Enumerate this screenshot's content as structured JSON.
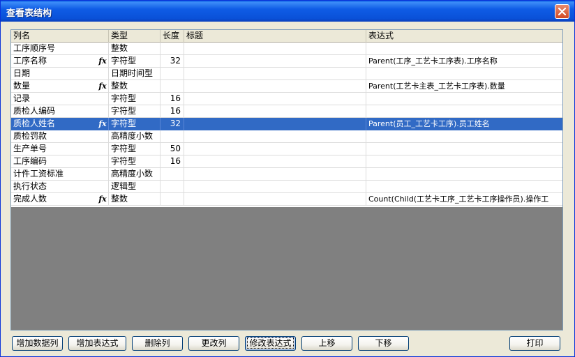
{
  "window": {
    "title": "查看表结构"
  },
  "grid": {
    "headers": {
      "name": "列名",
      "type": "类型",
      "length": "长度",
      "title": "标题",
      "expression": "表达式"
    },
    "rows": [
      {
        "name": "工序顺序号",
        "fx": "",
        "type": "整数",
        "length": "",
        "title": "",
        "expression": ""
      },
      {
        "name": "工序名称",
        "fx": "fx",
        "type": "字符型",
        "length": "32",
        "title": "",
        "expression": "Parent(工序_工艺卡工序表).工序名称"
      },
      {
        "name": "日期",
        "fx": "",
        "type": "日期时间型",
        "length": "",
        "title": "",
        "expression": ""
      },
      {
        "name": "数量",
        "fx": "fx",
        "type": "整数",
        "length": "",
        "title": "",
        "expression": "Parent(工艺卡主表_工艺卡工序表).数量"
      },
      {
        "name": "记录",
        "fx": "",
        "type": "字符型",
        "length": "16",
        "title": "",
        "expression": ""
      },
      {
        "name": "质检人编码",
        "fx": "",
        "type": "字符型",
        "length": "16",
        "title": "",
        "expression": ""
      },
      {
        "name": "质检人姓名",
        "fx": "fx",
        "type": "字符型",
        "length": "32",
        "title": "",
        "expression": "Parent(员工_工艺卡工序).员工姓名"
      },
      {
        "name": "质检罚款",
        "fx": "",
        "type": "高精度小数",
        "length": "",
        "title": "",
        "expression": ""
      },
      {
        "name": "生产单号",
        "fx": "",
        "type": "字符型",
        "length": "50",
        "title": "",
        "expression": ""
      },
      {
        "name": "工序编码",
        "fx": "",
        "type": "字符型",
        "length": "16",
        "title": "",
        "expression": ""
      },
      {
        "name": "计件工资标准",
        "fx": "",
        "type": "高精度小数",
        "length": "",
        "title": "",
        "expression": ""
      },
      {
        "name": "执行状态",
        "fx": "",
        "type": "逻辑型",
        "length": "",
        "title": "",
        "expression": ""
      },
      {
        "name": "完成人数",
        "fx": "fx",
        "type": "整数",
        "length": "",
        "title": "",
        "expression": "Count(Child(工艺卡工序_工艺卡工序操作员).操作工"
      }
    ],
    "selected_row_index": 6
  },
  "buttons": {
    "add_data_column": "增加数据列",
    "add_expression": "增加表达式",
    "delete_column": "删除列",
    "modify_column": "更改列",
    "modify_expression": "修改表达式",
    "move_up": "上移",
    "move_down": "下移",
    "print": "打印"
  },
  "colors": {
    "selection": "#316ac5",
    "titlebar": "#0a51d8",
    "empty_grid_area": "#808080"
  },
  "icons": {
    "close": "close-icon",
    "formula": "fx-icon"
  }
}
